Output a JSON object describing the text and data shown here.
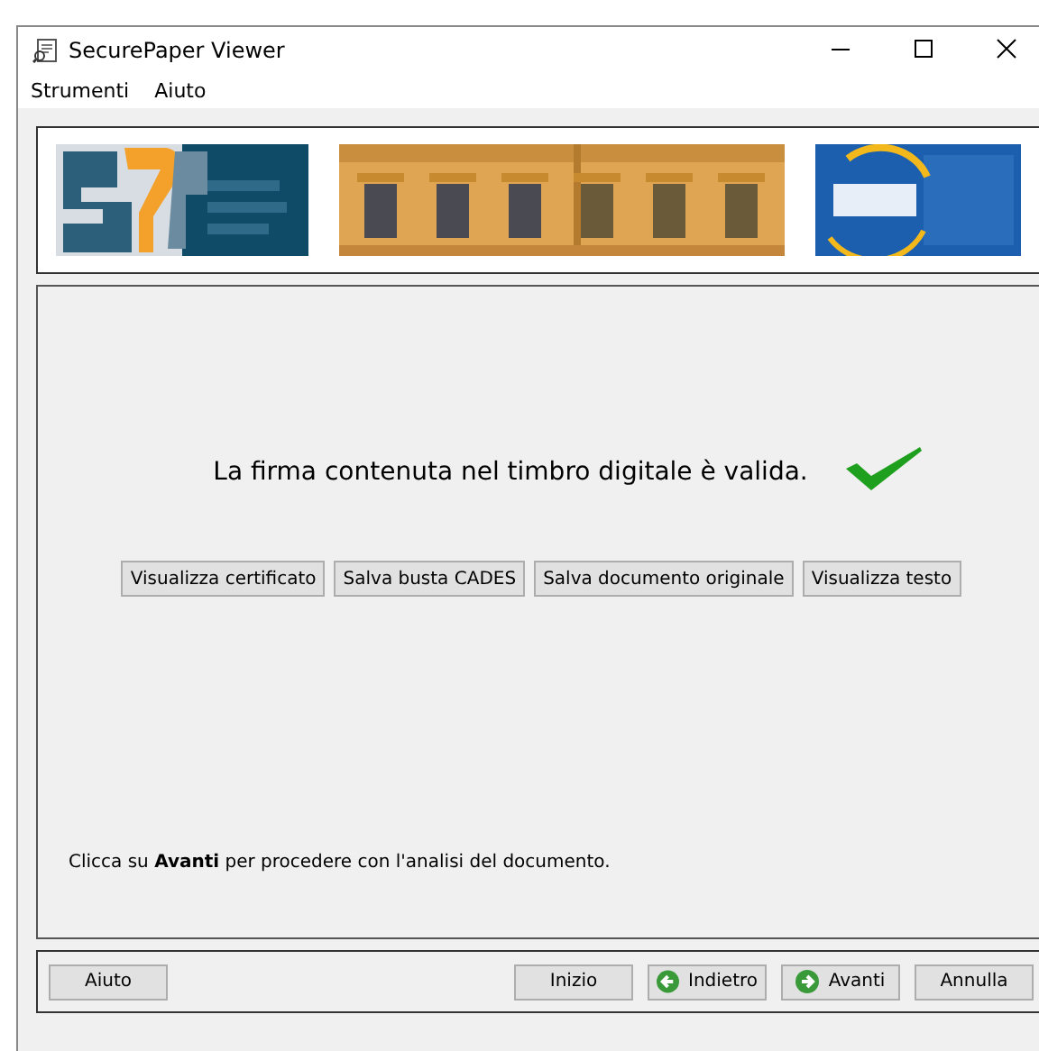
{
  "window": {
    "title": "SecurePaper Viewer"
  },
  "menu": [
    "Strumenti",
    "Aiuto"
  ],
  "banner": [
    {
      "kind": "picture"
    },
    {
      "kind": "picture"
    },
    {
      "kind": "picture"
    }
  ],
  "result": {
    "message": "La firma contenuta nel timbro digitale è valida.",
    "valid": true
  },
  "actions": [
    "Visualizza certificato",
    "Salva busta CADES",
    "Salva documento originale",
    "Visualizza testo"
  ],
  "hint": "Clicca su **Avanti** per procedere con l'analisi del documento.",
  "nav": [
    {
      "label": "Aiuto",
      "kind": "plain"
    },
    {
      "label": "Inizio",
      "kind": "plain"
    },
    {
      "label": "Indietro",
      "kind": "back"
    },
    {
      "label": "Avanti",
      "kind": "forward"
    },
    {
      "label": "Annulla",
      "kind": "plain"
    }
  ]
}
